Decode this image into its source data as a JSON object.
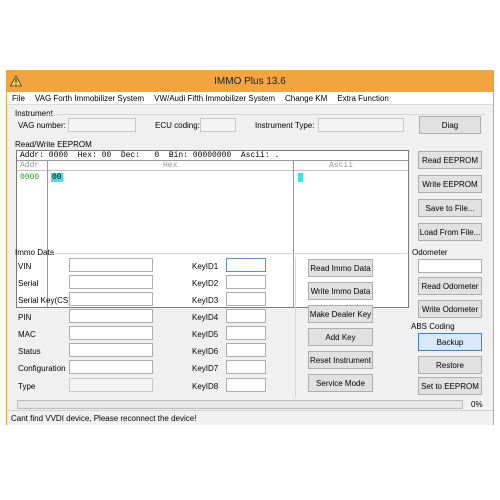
{
  "window": {
    "title": "IMMO Plus 13.6",
    "accent_color": "#f1a43f",
    "app_icon": "warning-triangle-icon"
  },
  "menu": [
    "File",
    "VAG Forth Immobilizer System",
    "VW/Audi Fifth Immobilizer System",
    "Change KM",
    "Extra Function"
  ],
  "instrument": {
    "group_label": "Instrument",
    "vag_number_label": "VAG number:",
    "vag_number_value": "",
    "ecu_coding_label": "ECU coding:",
    "ecu_coding_value": "",
    "instrument_type_label": "Instrument Type:",
    "instrument_type_value": "",
    "diag_button": "Diag"
  },
  "eeprom": {
    "group_label": "Read/Write EEPROM",
    "header_line": "Addr: 0000  Hex: 00  Dec:   0  Bin: 00000000  Ascii: .",
    "col_addr": "Addr",
    "col_hex": "Hex",
    "col_ascii": "Ascii",
    "row_addr": "0000",
    "row_hex": "00",
    "row_ascii": ".",
    "buttons": [
      "Read EEPROM",
      "Write EEPROM",
      "Save to File...",
      "Load From File..."
    ]
  },
  "immo": {
    "group_label": "Immo Data",
    "fields": [
      "VIN",
      "Serial",
      "Serial Key(CS)",
      "PIN",
      "MAC",
      "Status",
      "Configuration",
      "Type"
    ],
    "keys": [
      "KeyID1",
      "KeyID2",
      "KeyID3",
      "KeyID4",
      "KeyID5",
      "KeyID6",
      "KeyID7",
      "KeyID8"
    ],
    "buttons": [
      "Read Immo Data",
      "Write Immo Data",
      "Make Dealer Key",
      "Add Key",
      "Reset Instrument",
      "Service Mode"
    ]
  },
  "odometer": {
    "group_label": "Odometer",
    "value": "",
    "read_button": "Read Odometer",
    "write_button": "Write Odometer"
  },
  "abs": {
    "group_label": "ABS Coding",
    "backup_button": "Backup",
    "restore_button": "Restore",
    "set_button": "Set to EEPROM"
  },
  "status": {
    "message": "Cant find VVDI device, Please reconnect the device!",
    "progress_percent": 0,
    "progress_text": "0%"
  }
}
